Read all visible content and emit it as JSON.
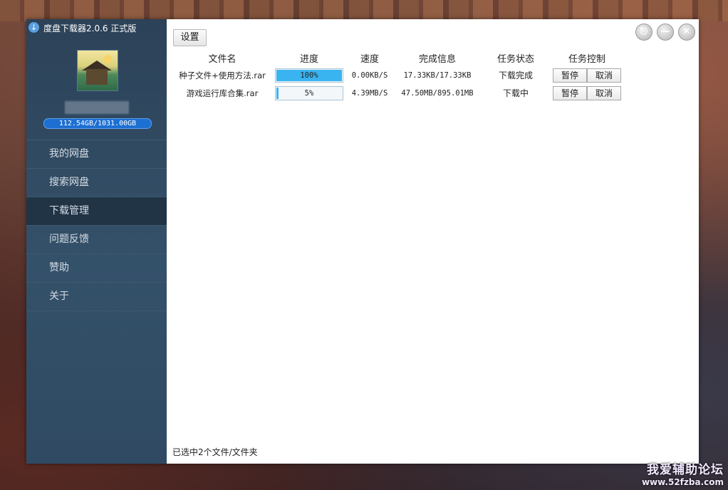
{
  "app": {
    "title": "度盘下载器2.0.6 正式版",
    "logo_icon": "download-arrow-icon"
  },
  "user": {
    "quota": "112.54GB/1031.00GB"
  },
  "sidebar": {
    "items": [
      {
        "label": "我的网盘"
      },
      {
        "label": "搜索网盘"
      },
      {
        "label": "下载管理"
      },
      {
        "label": "问题反馈"
      },
      {
        "label": "赞助"
      },
      {
        "label": "关于"
      }
    ],
    "active_index": 2
  },
  "toolbar": {
    "settings_label": "设置"
  },
  "window_buttons": {
    "logout": "⎋",
    "minimize": "—",
    "close": "✕"
  },
  "table": {
    "headers": [
      "文件名",
      "进度",
      "速度",
      "完成信息",
      "任务状态",
      "任务控制"
    ],
    "rows": [
      {
        "filename": "种子文件+使用方法.rar",
        "progress_text": "100%",
        "progress": 100,
        "speed": "0.00KB/S",
        "info": "17.33KB/17.33KB",
        "status": "下载完成",
        "pause": "暂停",
        "cancel": "取消"
      },
      {
        "filename": "游戏运行库合集.rar",
        "progress_text": "5%",
        "progress": 5,
        "speed": "4.39MB/S",
        "info": "47.50MB/895.01MB",
        "status": "下载中",
        "pause": "暂停",
        "cancel": "取消"
      }
    ]
  },
  "statusbar": {
    "text": "已选中2个文件/文件夹"
  },
  "watermark": {
    "line1": "我爱辅助论坛",
    "line2": "www.52fzba.com"
  },
  "colors": {
    "progress_fill": "#3ab4f0",
    "quota_bar": "#1d6fd2",
    "sidebar_bg": "#2c4258"
  }
}
